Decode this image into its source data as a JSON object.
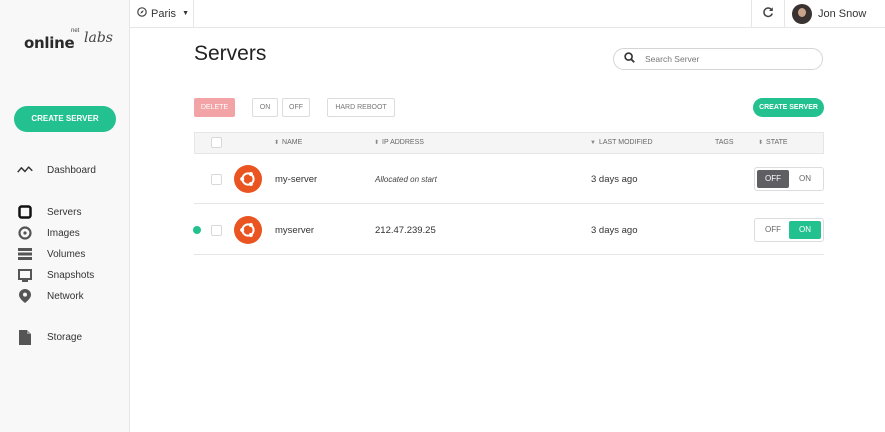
{
  "brand": {
    "logo_main": "online",
    "logo_net": "net",
    "logo_labs": "labs"
  },
  "sidebar": {
    "create_label": "CREATE SERVER",
    "items": [
      {
        "label": "Dashboard",
        "icon": "activity-icon"
      },
      {
        "label": "Servers",
        "icon": "server-icon"
      },
      {
        "label": "Images",
        "icon": "disc-icon"
      },
      {
        "label": "Volumes",
        "icon": "stack-icon"
      },
      {
        "label": "Snapshots",
        "icon": "snapshot-icon"
      },
      {
        "label": "Network",
        "icon": "map-pin-icon"
      },
      {
        "label": "Storage",
        "icon": "file-icon"
      }
    ]
  },
  "topbar": {
    "region": "Paris",
    "user": "Jon Snow"
  },
  "main": {
    "title": "Servers",
    "search_placeholder": "Search Server",
    "actions": {
      "delete": "DELETE",
      "on": "ON",
      "off": "OFF",
      "hard_reboot": "HARD REBOOT",
      "create": "CREATE SERVER"
    },
    "columns": {
      "name": "NAME",
      "ip": "IP ADDRESS",
      "modified": "LAST MODIFIED",
      "tags": "TAGS",
      "state": "STATE"
    },
    "rows": [
      {
        "name": "my-server",
        "ip": "Allocated on start",
        "modified": "3 days ago",
        "tags": "",
        "state": "OFF",
        "running": false
      },
      {
        "name": "myserver",
        "ip": "212.47.239.25",
        "modified": "3 days ago",
        "tags": "",
        "state": "ON",
        "running": true
      }
    ],
    "toggle_off": "OFF",
    "toggle_on": "ON"
  },
  "colors": {
    "accent": "#23c18f",
    "danger_light": "#f2a3a6",
    "ubuntu": "#e95420",
    "toggle_off_active": "#5f5f63"
  }
}
